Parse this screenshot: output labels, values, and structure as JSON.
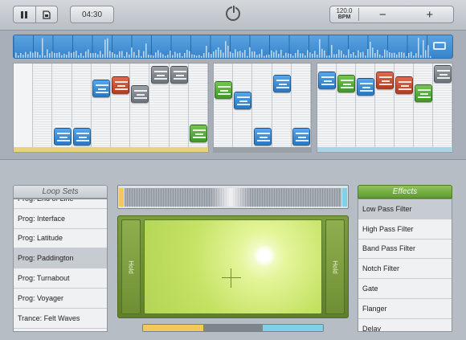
{
  "transport": {
    "pause_icon": "pause-icon",
    "save_icon": "save-icon"
  },
  "time": "04:30",
  "power_icon": "power-icon",
  "tempo": {
    "value": "120.0",
    "unit": "BPM",
    "minus": "−",
    "plus": "+"
  },
  "waveform": {
    "loop_icon": "loop-icon"
  },
  "grid_sections": [
    {
      "columns": 10,
      "footer_color": "#e8d27a"
    },
    {
      "columns": 5,
      "footer_color": "#9aa0a7"
    },
    {
      "columns": 7,
      "footer_color": "#a9d6e6"
    }
  ],
  "loop_sets": {
    "title": "Loop Sets",
    "items": [
      "Prog: End of Line",
      "Prog: Interface",
      "Prog: Latitude",
      "Prog: Paddington",
      "Prog: Turnabout",
      "Prog: Voyager",
      "Trance: Felt Waves"
    ],
    "selected": "Prog: Paddington"
  },
  "effects": {
    "title": "Effects",
    "items": [
      "Low Pass Filter",
      "High Pass Filter",
      "Band Pass Filter",
      "Notch Filter",
      "Gate",
      "Flanger",
      "Delay"
    ],
    "selected": "Low Pass Filter"
  },
  "xy_pad": {
    "hold_left": "Hold",
    "hold_right": "Hold"
  },
  "mix_colors": [
    "#f2c85a",
    "#7e858c",
    "#7fd0e8"
  ],
  "colors": {
    "blue": "#3d8fd9",
    "green": "#55b03a",
    "red": "#c84e33",
    "gray": "#858c94",
    "accent_fx": "#74ac44"
  }
}
